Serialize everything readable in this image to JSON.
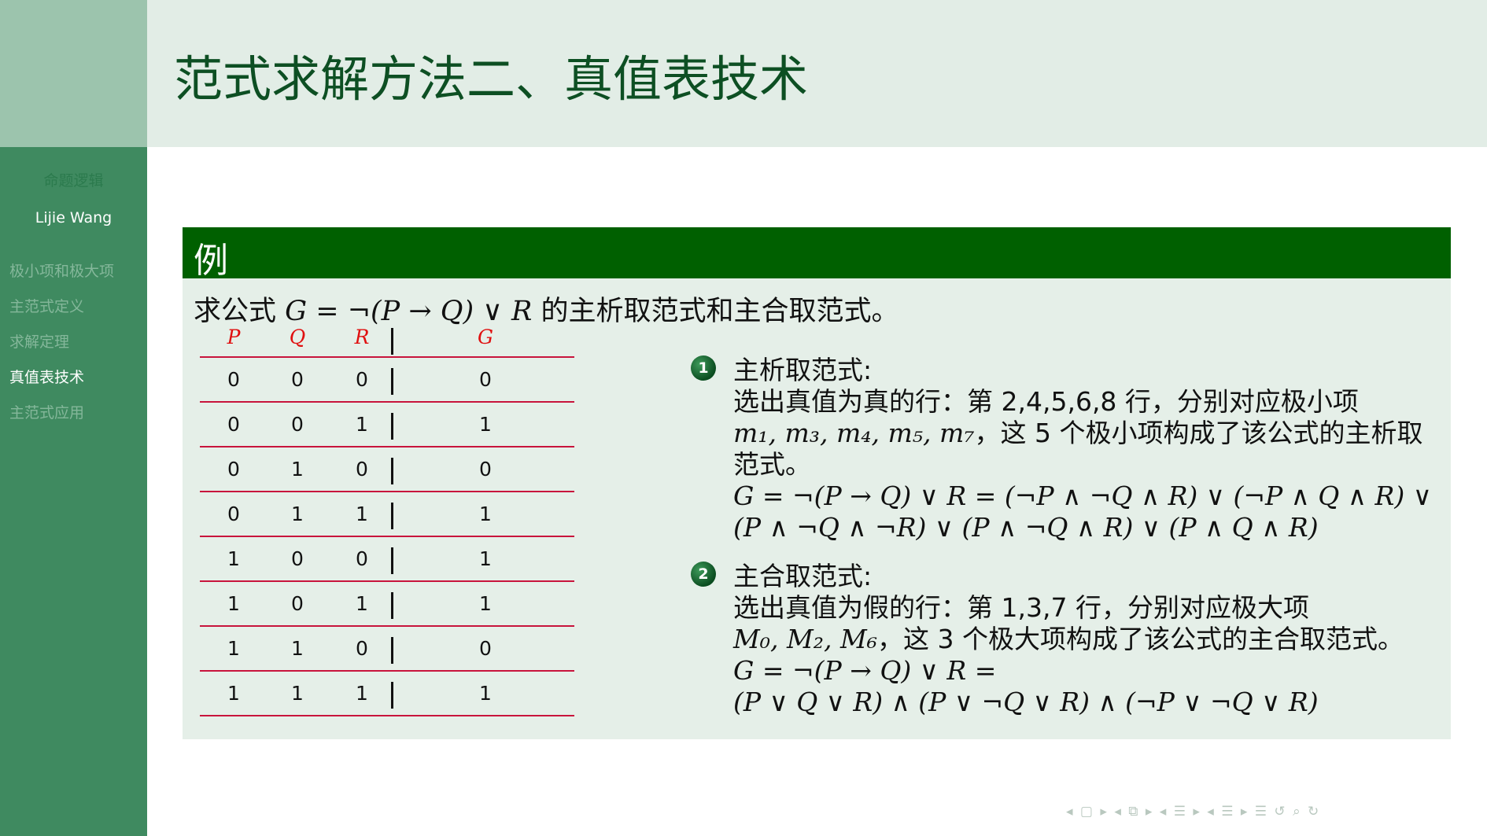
{
  "sidebar": {
    "title": "命题逻辑",
    "author": "Lijie Wang",
    "items": [
      {
        "label": "极小项和极大项"
      },
      {
        "label": "主范式定义"
      },
      {
        "label": "求解定理"
      },
      {
        "label": "真值表技术"
      },
      {
        "label": "主范式应用"
      }
    ]
  },
  "header": {
    "title": "范式求解方法二、真值表技术"
  },
  "block": {
    "title": "例",
    "question_pre": "求公式",
    "question_formula": "G = ¬(P → Q) ∨ R",
    "question_post": "的主析取范式和主合取范式。",
    "truth_table": {
      "headers": [
        "P",
        "Q",
        "R",
        "G"
      ],
      "rows": [
        [
          "0",
          "0",
          "0",
          "0"
        ],
        [
          "0",
          "0",
          "1",
          "1"
        ],
        [
          "0",
          "1",
          "0",
          "0"
        ],
        [
          "0",
          "1",
          "1",
          "1"
        ],
        [
          "1",
          "0",
          "0",
          "1"
        ],
        [
          "1",
          "0",
          "1",
          "1"
        ],
        [
          "1",
          "1",
          "0",
          "0"
        ],
        [
          "1",
          "1",
          "1",
          "1"
        ]
      ]
    },
    "points": [
      {
        "num": "1",
        "heading": "主析取范式:",
        "line1": "选出真值为真的行：第 2,4,5,6,8 行，分别对应极小项",
        "line2_math": "m₁, m₃, m₄, m₅, m₇",
        "line2_text": "，这 5 个极小项构成了该公式的主析取",
        "line3": "范式。",
        "line4": "G = ¬(P → Q) ∨ R = (¬P ∧ ¬Q ∧ R) ∨ (¬P ∧ Q ∧ R) ∨",
        "line5": "(P ∧ ¬Q ∧ ¬R) ∨ (P ∧ ¬Q ∧ R) ∨ (P ∧ Q ∧ R)"
      },
      {
        "num": "2",
        "heading": "主合取范式:",
        "line1": "选出真值为假的行：第 1,3,7 行，分别对应极大项",
        "line2_math": "M₀, M₂, M₆",
        "line2_text": "，这 3 个极大项构成了该公式的主合取范式。",
        "line3": "G = ¬(P → Q) ∨ R =",
        "line4": "(P ∨ Q ∨ R) ∧ (P ∨ ¬Q ∨ R) ∧ (¬P ∨ ¬Q ∨ R)"
      }
    ]
  },
  "nav": {
    "symbols": "◂ ▢ ▸ ◂ ⧉ ▸ ◂ ☰ ▸ ◂ ☰ ▸   ☰   ↺ ⌕ ↻"
  }
}
